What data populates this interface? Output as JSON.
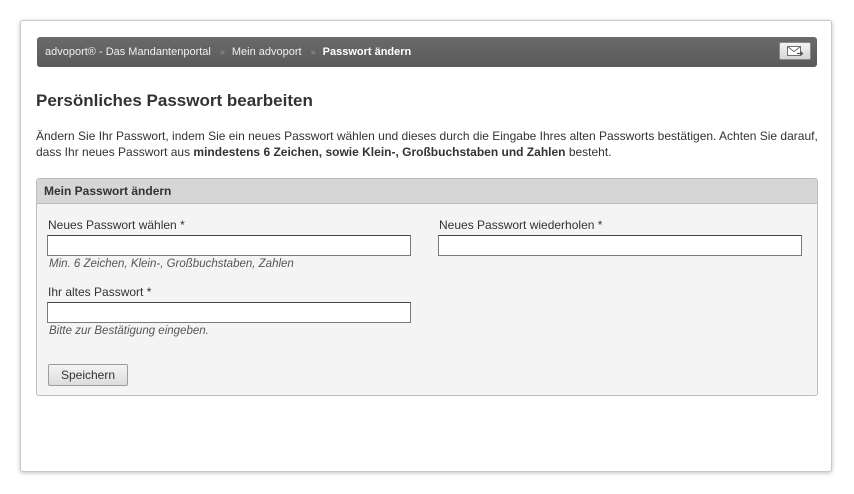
{
  "breadcrumb": {
    "items": [
      {
        "label": "advoport® - Das Mandantenportal"
      },
      {
        "label": "Mein advoport"
      },
      {
        "label": "Passwort ändern"
      }
    ],
    "separator": "»"
  },
  "header": {
    "mail_icon": "envelope-arrow-icon"
  },
  "page": {
    "title": "Persönliches Passwort bearbeiten",
    "intro_part1": "Ändern Sie Ihr Passwort, indem Sie ein neues Passwort wählen und dieses durch die Eingabe Ihres alten Passworts bestätigen. Achten Sie darauf, dass Ihr neues Passwort aus ",
    "intro_bold": "mindestens 6 Zeichen, sowie Klein-, Großbuchstaben und Zahlen",
    "intro_part2": " besteht."
  },
  "form": {
    "title": "Mein Passwort ändern",
    "new_password": {
      "label": "Neues Passwort wählen *",
      "value": "",
      "hint": "Min. 6 Zeichen, Klein-, Großbuchstaben, Zahlen"
    },
    "repeat_password": {
      "label": "Neues Passwort wiederholen *",
      "value": ""
    },
    "old_password": {
      "label": "Ihr altes Passwort *",
      "value": "",
      "hint": "Bitte zur Bestätigung eingeben."
    },
    "save_label": "Speichern"
  },
  "colors": {
    "breadcrumb_bg": "#5f5f5f",
    "panel_header_bg": "#d6d6d6",
    "panel_bg": "#f4f4f4"
  }
}
